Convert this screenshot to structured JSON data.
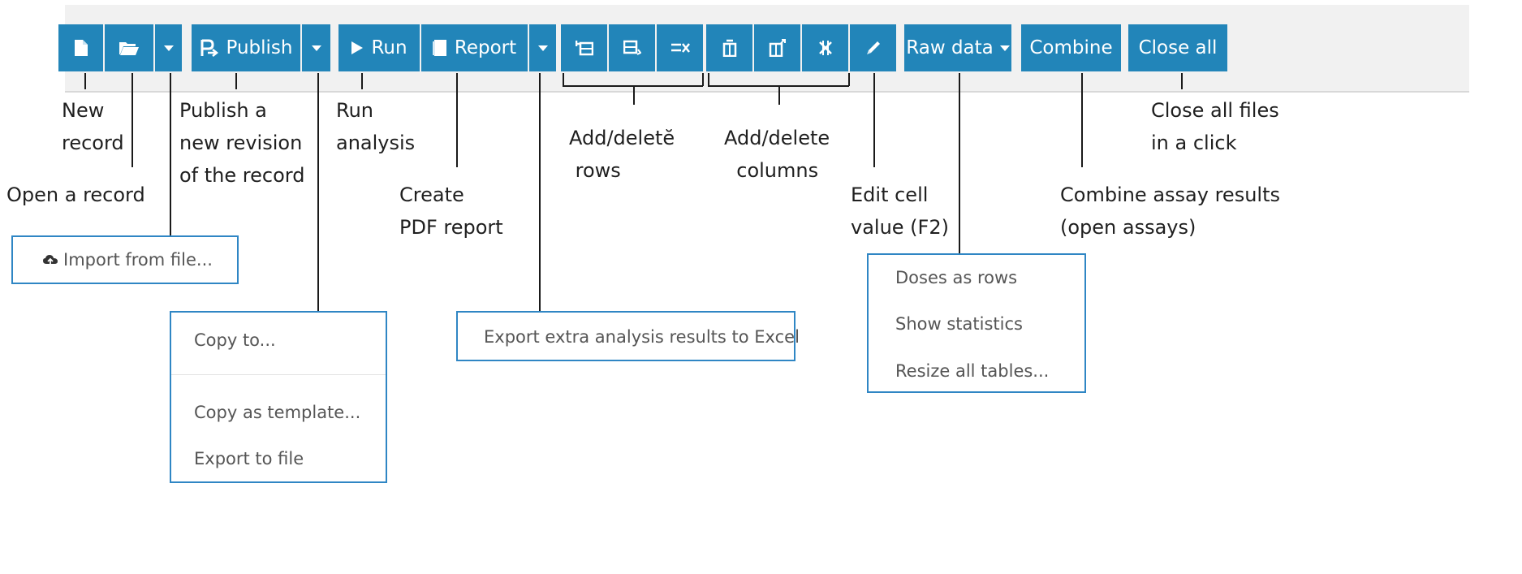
{
  "toolbar": {
    "publish_label": "Publish",
    "run_label": "Run",
    "report_label": "Report",
    "raw_data_label": "Raw data",
    "combine_label": "Combine",
    "close_all_label": "Close all"
  },
  "annotations": {
    "new_record": "New\nrecord",
    "open_record": "Open a record",
    "publish_revision": "Publish a\nnew revision\nof the record",
    "run_analysis": "Run\nanalysis",
    "create_pdf": "Create\nPDF report",
    "add_delete_rows": "Add/deletĕ\n rows",
    "add_delete_columns": "Add/delete\n  columns",
    "edit_cell": "Edit cell\nvalue (F2)",
    "combine_results": "Combine assay results\n(open assays)",
    "close_all_files": "Close all files\nin a click"
  },
  "menus": {
    "open_menu": {
      "items": [
        "Import from file..."
      ]
    },
    "publish_menu": {
      "items": [
        "Copy to...",
        "Copy as template...",
        "Export to file"
      ]
    },
    "report_menu": {
      "items": [
        "Export extra analysis results to Excel"
      ]
    },
    "raw_data_menu": {
      "items": [
        "Doses as rows",
        "Show statistics",
        "Resize all tables..."
      ]
    }
  },
  "colors": {
    "button_blue": "#2285b9",
    "menu_border": "#2f86c4",
    "toolbar_bg": "#f1f1f1"
  },
  "icons": [
    "new-file-icon",
    "folder-open-icon",
    "caret-down-icon",
    "publish-icon",
    "play-icon",
    "report-icon",
    "add-row-icon",
    "insert-row-icon",
    "delete-row-icon",
    "add-column-icon",
    "insert-column-icon",
    "delete-column-icon",
    "pencil-icon",
    "cloud-upload-icon"
  ]
}
